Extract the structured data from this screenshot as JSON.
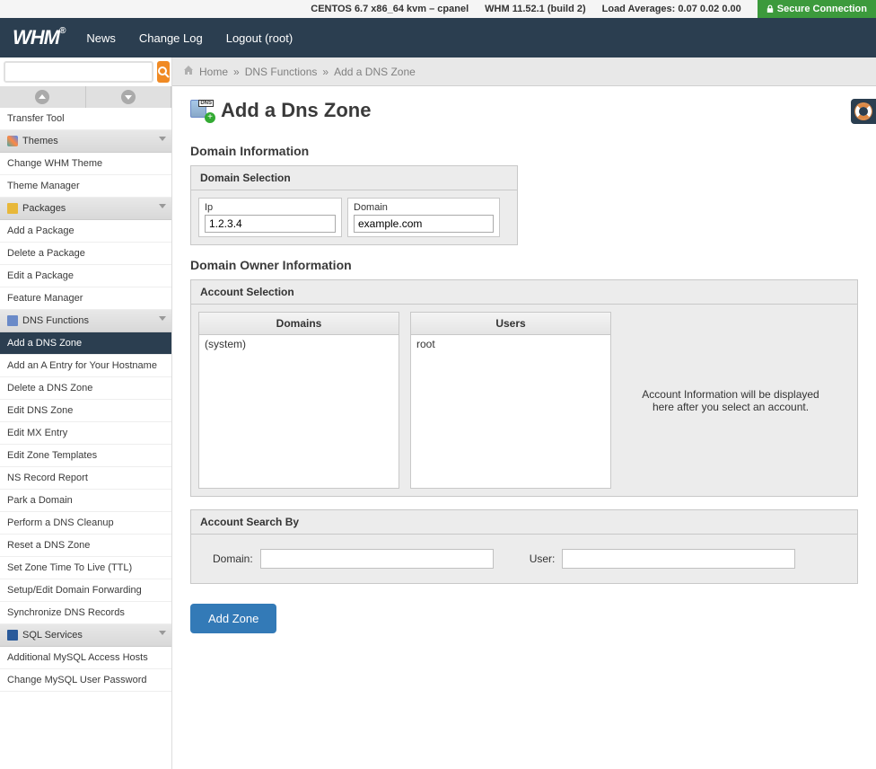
{
  "statusbar": {
    "os": "CENTOS 6.7 x86_64 kvm – cpanel",
    "whm": "WHM 11.52.1 (build 2)",
    "load_label": "Load Averages:",
    "loads": "0.07 0.02 0.00",
    "secure": "Secure Connection"
  },
  "nav": {
    "logo": "WHM",
    "news": "News",
    "changelog": "Change Log",
    "logout": "Logout (root)"
  },
  "breadcrumb": {
    "home": "Home",
    "sep": "»",
    "fn": "DNS Functions",
    "page": "Add a DNS Zone"
  },
  "sidebar": {
    "transfer_tool": "Transfer Tool",
    "themes_hdr": "Themes",
    "change_whm_theme": "Change WHM Theme",
    "theme_manager": "Theme Manager",
    "packages_hdr": "Packages",
    "add_package": "Add a Package",
    "delete_package": "Delete a Package",
    "edit_package": "Edit a Package",
    "feature_manager": "Feature Manager",
    "dns_hdr": "DNS Functions",
    "add_dns_zone": "Add a DNS Zone",
    "add_a_entry": "Add an A Entry for Your Hostname",
    "delete_dns_zone": "Delete a DNS Zone",
    "edit_dns_zone": "Edit DNS Zone",
    "edit_mx": "Edit MX Entry",
    "edit_zone_tmpl": "Edit Zone Templates",
    "ns_record": "NS Record Report",
    "park_domain": "Park a Domain",
    "dns_cleanup": "Perform a DNS Cleanup",
    "reset_dns": "Reset a DNS Zone",
    "set_ttl": "Set Zone Time To Live (TTL)",
    "setup_fwd": "Setup/Edit Domain Forwarding",
    "sync_dns": "Synchronize DNS Records",
    "sql_hdr": "SQL Services",
    "mysql_hosts": "Additional MySQL Access Hosts",
    "mysql_pwd": "Change MySQL User Password"
  },
  "page": {
    "title": "Add a Dns Zone",
    "domain_info_hdr": "Domain Information",
    "domain_sel_hdr": "Domain Selection",
    "ip_label": "Ip",
    "ip_value": "1.2.3.4",
    "domain_label": "Domain",
    "domain_value": "example.com",
    "owner_info_hdr": "Domain Owner Information",
    "account_sel_hdr": "Account Selection",
    "domains_col": "Domains",
    "users_col": "Users",
    "domains_item": "(system)",
    "users_item": "root",
    "acct_info_text": "Account Information will be displayed here after you select an account.",
    "search_hdr": "Account Search By",
    "search_domain_label": "Domain:",
    "search_user_label": "User:",
    "add_btn": "Add Zone"
  }
}
